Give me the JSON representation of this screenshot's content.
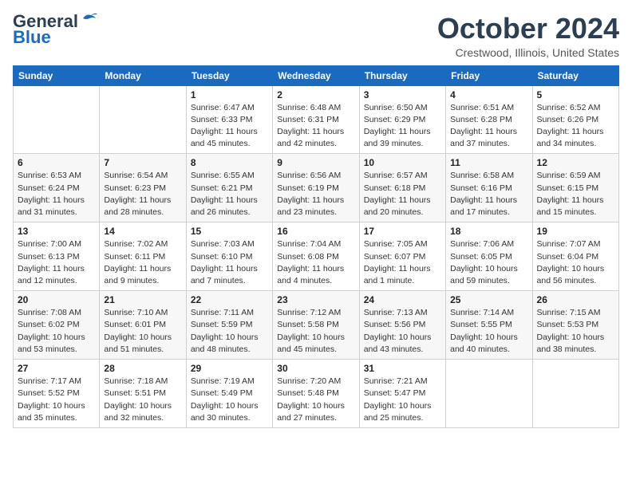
{
  "header": {
    "logo_general": "General",
    "logo_blue": "Blue",
    "month_title": "October 2024",
    "location": "Crestwood, Illinois, United States"
  },
  "days_of_week": [
    "Sunday",
    "Monday",
    "Tuesday",
    "Wednesday",
    "Thursday",
    "Friday",
    "Saturday"
  ],
  "weeks": [
    [
      {
        "day": "",
        "info": ""
      },
      {
        "day": "",
        "info": ""
      },
      {
        "day": "1",
        "info": "Sunrise: 6:47 AM\nSunset: 6:33 PM\nDaylight: 11 hours and 45 minutes."
      },
      {
        "day": "2",
        "info": "Sunrise: 6:48 AM\nSunset: 6:31 PM\nDaylight: 11 hours and 42 minutes."
      },
      {
        "day": "3",
        "info": "Sunrise: 6:50 AM\nSunset: 6:29 PM\nDaylight: 11 hours and 39 minutes."
      },
      {
        "day": "4",
        "info": "Sunrise: 6:51 AM\nSunset: 6:28 PM\nDaylight: 11 hours and 37 minutes."
      },
      {
        "day": "5",
        "info": "Sunrise: 6:52 AM\nSunset: 6:26 PM\nDaylight: 11 hours and 34 minutes."
      }
    ],
    [
      {
        "day": "6",
        "info": "Sunrise: 6:53 AM\nSunset: 6:24 PM\nDaylight: 11 hours and 31 minutes."
      },
      {
        "day": "7",
        "info": "Sunrise: 6:54 AM\nSunset: 6:23 PM\nDaylight: 11 hours and 28 minutes."
      },
      {
        "day": "8",
        "info": "Sunrise: 6:55 AM\nSunset: 6:21 PM\nDaylight: 11 hours and 26 minutes."
      },
      {
        "day": "9",
        "info": "Sunrise: 6:56 AM\nSunset: 6:19 PM\nDaylight: 11 hours and 23 minutes."
      },
      {
        "day": "10",
        "info": "Sunrise: 6:57 AM\nSunset: 6:18 PM\nDaylight: 11 hours and 20 minutes."
      },
      {
        "day": "11",
        "info": "Sunrise: 6:58 AM\nSunset: 6:16 PM\nDaylight: 11 hours and 17 minutes."
      },
      {
        "day": "12",
        "info": "Sunrise: 6:59 AM\nSunset: 6:15 PM\nDaylight: 11 hours and 15 minutes."
      }
    ],
    [
      {
        "day": "13",
        "info": "Sunrise: 7:00 AM\nSunset: 6:13 PM\nDaylight: 11 hours and 12 minutes."
      },
      {
        "day": "14",
        "info": "Sunrise: 7:02 AM\nSunset: 6:11 PM\nDaylight: 11 hours and 9 minutes."
      },
      {
        "day": "15",
        "info": "Sunrise: 7:03 AM\nSunset: 6:10 PM\nDaylight: 11 hours and 7 minutes."
      },
      {
        "day": "16",
        "info": "Sunrise: 7:04 AM\nSunset: 6:08 PM\nDaylight: 11 hours and 4 minutes."
      },
      {
        "day": "17",
        "info": "Sunrise: 7:05 AM\nSunset: 6:07 PM\nDaylight: 11 hours and 1 minute."
      },
      {
        "day": "18",
        "info": "Sunrise: 7:06 AM\nSunset: 6:05 PM\nDaylight: 10 hours and 59 minutes."
      },
      {
        "day": "19",
        "info": "Sunrise: 7:07 AM\nSunset: 6:04 PM\nDaylight: 10 hours and 56 minutes."
      }
    ],
    [
      {
        "day": "20",
        "info": "Sunrise: 7:08 AM\nSunset: 6:02 PM\nDaylight: 10 hours and 53 minutes."
      },
      {
        "day": "21",
        "info": "Sunrise: 7:10 AM\nSunset: 6:01 PM\nDaylight: 10 hours and 51 minutes."
      },
      {
        "day": "22",
        "info": "Sunrise: 7:11 AM\nSunset: 5:59 PM\nDaylight: 10 hours and 48 minutes."
      },
      {
        "day": "23",
        "info": "Sunrise: 7:12 AM\nSunset: 5:58 PM\nDaylight: 10 hours and 45 minutes."
      },
      {
        "day": "24",
        "info": "Sunrise: 7:13 AM\nSunset: 5:56 PM\nDaylight: 10 hours and 43 minutes."
      },
      {
        "day": "25",
        "info": "Sunrise: 7:14 AM\nSunset: 5:55 PM\nDaylight: 10 hours and 40 minutes."
      },
      {
        "day": "26",
        "info": "Sunrise: 7:15 AM\nSunset: 5:53 PM\nDaylight: 10 hours and 38 minutes."
      }
    ],
    [
      {
        "day": "27",
        "info": "Sunrise: 7:17 AM\nSunset: 5:52 PM\nDaylight: 10 hours and 35 minutes."
      },
      {
        "day": "28",
        "info": "Sunrise: 7:18 AM\nSunset: 5:51 PM\nDaylight: 10 hours and 32 minutes."
      },
      {
        "day": "29",
        "info": "Sunrise: 7:19 AM\nSunset: 5:49 PM\nDaylight: 10 hours and 30 minutes."
      },
      {
        "day": "30",
        "info": "Sunrise: 7:20 AM\nSunset: 5:48 PM\nDaylight: 10 hours and 27 minutes."
      },
      {
        "day": "31",
        "info": "Sunrise: 7:21 AM\nSunset: 5:47 PM\nDaylight: 10 hours and 25 minutes."
      },
      {
        "day": "",
        "info": ""
      },
      {
        "day": "",
        "info": ""
      }
    ]
  ]
}
